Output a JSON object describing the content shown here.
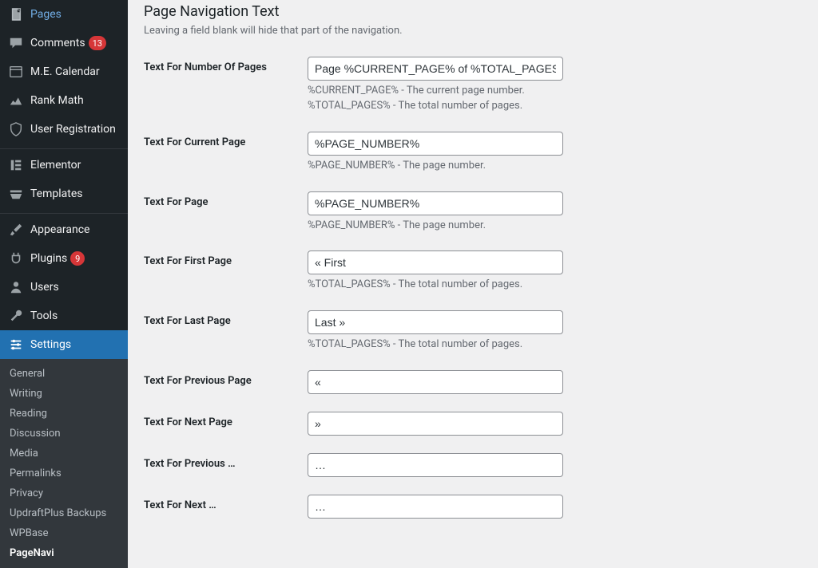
{
  "sidebar": {
    "items": [
      {
        "label": "Pages",
        "icon": "pages",
        "badge": null
      },
      {
        "label": "Comments",
        "icon": "comment",
        "badge": "13"
      },
      {
        "label": "M.E. Calendar",
        "icon": "calendar",
        "badge": null
      },
      {
        "label": "Rank Math",
        "icon": "analytics",
        "badge": null
      },
      {
        "label": "User Registration",
        "icon": "shield",
        "badge": null
      },
      {
        "label": "Elementor",
        "icon": "elementor",
        "badge": null
      },
      {
        "label": "Templates",
        "icon": "templates",
        "badge": null
      },
      {
        "label": "Appearance",
        "icon": "brush",
        "badge": null
      },
      {
        "label": "Plugins",
        "icon": "plug",
        "badge": "9"
      },
      {
        "label": "Users",
        "icon": "user",
        "badge": null
      },
      {
        "label": "Tools",
        "icon": "wrench",
        "badge": null
      },
      {
        "label": "Settings",
        "icon": "sliders",
        "badge": null
      }
    ],
    "submenu": [
      "General",
      "Writing",
      "Reading",
      "Discussion",
      "Media",
      "Permalinks",
      "Privacy",
      "UpdraftPlus Backups",
      "WPBase",
      "PageNavi"
    ],
    "submenu_current": "PageNavi"
  },
  "page": {
    "title": "Page Navigation Text",
    "desc": "Leaving a field blank will hide that part of the navigation."
  },
  "fields": [
    {
      "label": "Text For Number Of Pages",
      "value": "Page %CURRENT_PAGE% of %TOTAL_PAGES%",
      "help": "%CURRENT_PAGE% - The current page number.\n%TOTAL_PAGES% - The total number of pages."
    },
    {
      "label": "Text For Current Page",
      "value": "%PAGE_NUMBER%",
      "help": "%PAGE_NUMBER% - The page number."
    },
    {
      "label": "Text For Page",
      "value": "%PAGE_NUMBER%",
      "help": "%PAGE_NUMBER% - The page number."
    },
    {
      "label": "Text For First Page",
      "value": "« First",
      "help": "%TOTAL_PAGES% - The total number of pages."
    },
    {
      "label": "Text For Last Page",
      "value": "Last »",
      "help": "%TOTAL_PAGES% - The total number of pages."
    },
    {
      "label": "Text For Previous Page",
      "value": "«",
      "help": ""
    },
    {
      "label": "Text For Next Page",
      "value": "»",
      "help": ""
    },
    {
      "label": "Text For Previous …",
      "value": "…",
      "help": ""
    },
    {
      "label": "Text For Next …",
      "value": "…",
      "help": ""
    }
  ]
}
